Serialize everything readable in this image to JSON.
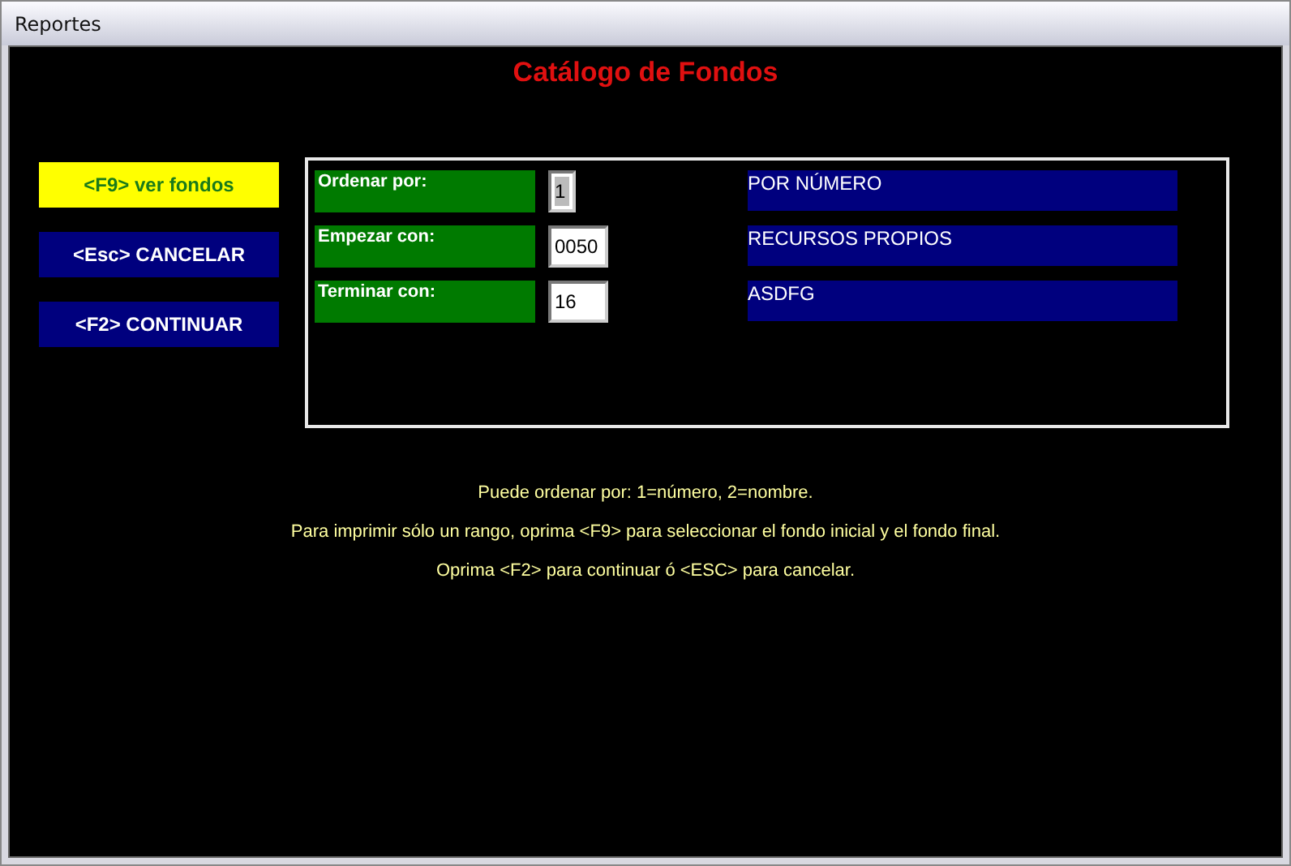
{
  "window": {
    "title": "Reportes"
  },
  "heading": "Catálogo de Fondos",
  "buttons": [
    {
      "label": "<F9> ver fondos",
      "selected": true
    },
    {
      "label": "<Esc> CANCELAR",
      "selected": false
    },
    {
      "label": "<F2> CONTINUAR",
      "selected": false
    }
  ],
  "fields": [
    {
      "label": "Ordenar por:",
      "value": "1",
      "selected": true,
      "description": "POR NÚMERO"
    },
    {
      "label": "Empezar con:",
      "value": "0050",
      "selected": false,
      "description": "RECURSOS PROPIOS"
    },
    {
      "label": "Terminar con:",
      "value": "16",
      "selected": false,
      "description": "ASDFG"
    }
  ],
  "instructions": [
    "Puede ordenar por: 1=número, 2=nombre.",
    "Para imprimir sólo un rango, oprima <F9> para seleccionar el fondo inicial y el fondo final.",
    "Oprima <F2> para continuar ó <ESC> para cancelar."
  ]
}
